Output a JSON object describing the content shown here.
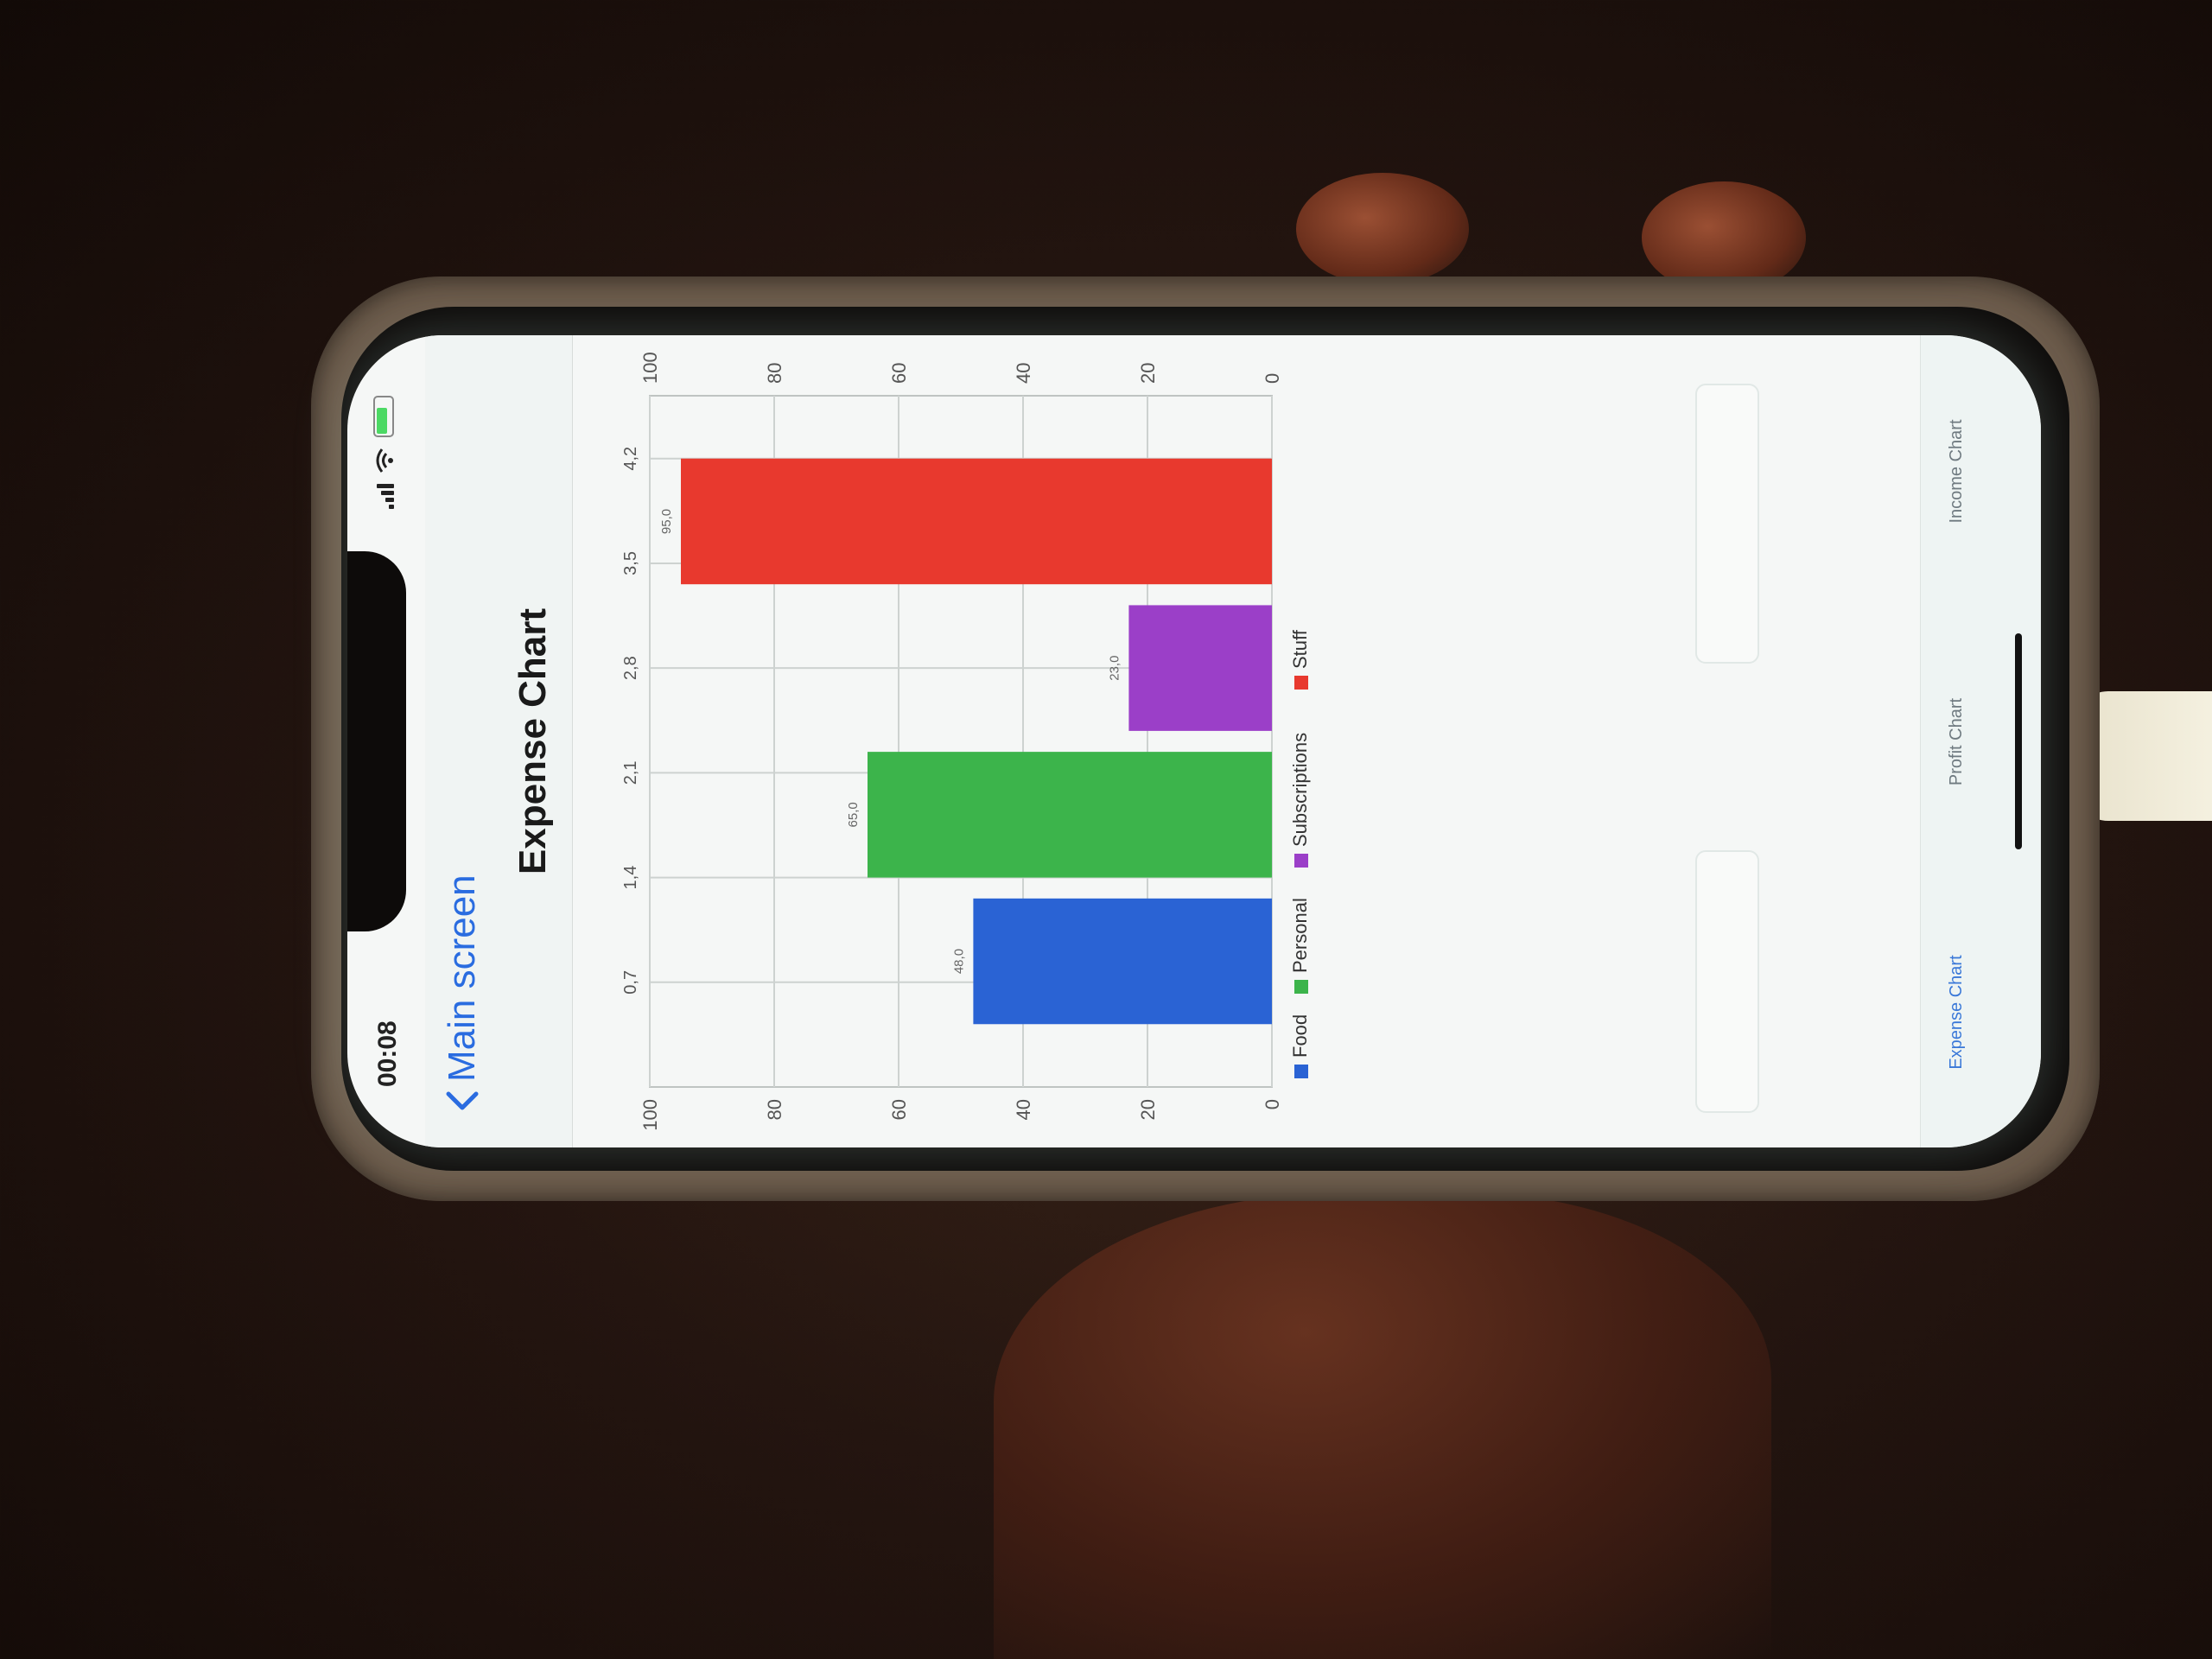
{
  "status_bar": {
    "time": "00:08"
  },
  "nav": {
    "back_label": "Main screen",
    "title": "Expense Chart"
  },
  "tabs": [
    {
      "label": "Expense Chart",
      "active": true
    },
    {
      "label": "Profit Chart",
      "active": false
    },
    {
      "label": "Income Chart",
      "active": false
    }
  ],
  "chart_data": {
    "type": "bar",
    "categories": [
      "Food",
      "Personal",
      "Subscriptions",
      "Stuff"
    ],
    "values": [
      48.0,
      65.0,
      23.0,
      95.0
    ],
    "value_labels": [
      "48,0",
      "65,0",
      "23,0",
      "95,0"
    ],
    "colors": [
      "#2a63d4",
      "#3cb44b",
      "#9b3fc8",
      "#e8392e"
    ],
    "x_ticks": [
      "0,7",
      "1,4",
      "2,1",
      "2,8",
      "3,5",
      "4,2"
    ],
    "x_positions": [
      0.7,
      1.4,
      2.1,
      2.8,
      3.5,
      4.2
    ],
    "bar_x": [
      0.84,
      1.82,
      2.8,
      3.78
    ],
    "bar_width": 0.84,
    "xlim": [
      0,
      4.62
    ],
    "y_ticks": [
      "0",
      "20",
      "40",
      "60",
      "80",
      "100"
    ],
    "ylim": [
      0,
      100
    ],
    "grid": true,
    "legend_position": "bottom"
  }
}
